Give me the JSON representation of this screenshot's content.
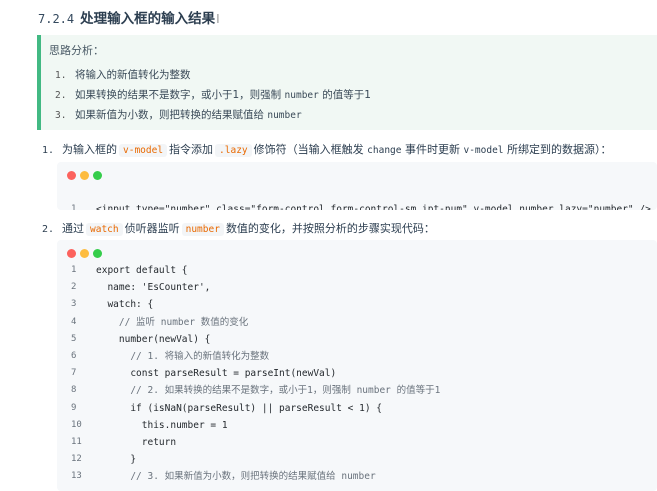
{
  "heading": {
    "number": "7.2.4",
    "title": "处理输入框的输入结果",
    "cursor": "I"
  },
  "tip": {
    "title": "思路分析：",
    "items": [
      {
        "idx": "1.",
        "parts": [
          "将输入的新值转化为整数"
        ]
      },
      {
        "idx": "2.",
        "parts": [
          "如果转换的结果不是数字，或小于1，则强制 ",
          "number",
          " 的值等于1"
        ]
      },
      {
        "idx": "3.",
        "parts": [
          "如果新值为小数，则把转换的结果赋值给 ",
          "number"
        ]
      }
    ]
  },
  "step1": {
    "idx": "1.",
    "t1": "为输入框的",
    "c1": "v-model",
    "t2": "指令添加",
    "c2": ".lazy",
    "t3": "修饰符（当输入框触发 ",
    "m1": "change",
    "t4": " 事件时更新 ",
    "m2": "v-model",
    "t5": " 所绑定到的数据源）："
  },
  "code1": {
    "lines": [
      {
        "n": "1",
        "text": "<input type=\"number\" class=\"form-control form-control-sm ipt-num\" v-model.number.lazy=\"number\" />"
      }
    ]
  },
  "step2": {
    "idx": "2.",
    "t1": "通过",
    "c1": "watch",
    "t2": "侦听器监听",
    "c2": "number",
    "t3": "数值的变化，并按照分析的步骤实现代码："
  },
  "code2": {
    "lines": [
      {
        "n": "1",
        "text": "export default {"
      },
      {
        "n": "2",
        "text": "  name: 'EsCounter',"
      },
      {
        "n": "3",
        "text": "  watch: {"
      },
      {
        "n": "4",
        "text": "    // 监听 number 数值的变化"
      },
      {
        "n": "5",
        "text": "    number(newVal) {"
      },
      {
        "n": "6",
        "text": "      // 1. 将输入的新值转化为整数"
      },
      {
        "n": "7",
        "text": "      const parseResult = parseInt(newVal)"
      },
      {
        "n": "8",
        "text": "      // 2. 如果转换的结果不是数字，或小于1，则强制 number 的值等于1"
      },
      {
        "n": "9",
        "text": "      if (isNaN(parseResult) || parseResult < 1) {"
      },
      {
        "n": "10",
        "text": "        this.number = 1"
      },
      {
        "n": "11",
        "text": "        return"
      },
      {
        "n": "12",
        "text": "      }"
      },
      {
        "n": "13",
        "text": "      // 3. 如果新值为小数，则把转换的结果赋值给 number"
      }
    ]
  },
  "colors": {
    "accent": "#42b983",
    "inline_code": "#e96900",
    "code_bg": "#f6f8fa",
    "tip_bg": "#f1f8f4"
  }
}
